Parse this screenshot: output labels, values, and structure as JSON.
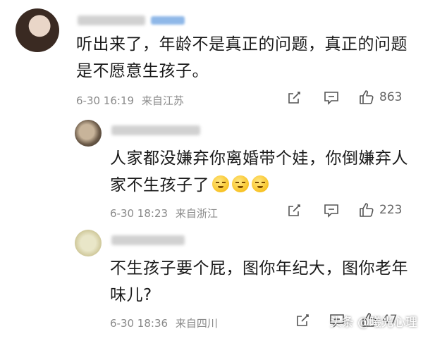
{
  "comments": [
    {
      "text": "听出来了，年龄不是真正的问题，真正的问题是不愿意生孩子。",
      "time": "6-30 16:19",
      "location": "来自江苏",
      "likes": "863"
    },
    {
      "text": "人家都没嫌弃你离婚带个娃，你倒嫌弃人家不生孩子了",
      "time": "6-30 18:23",
      "location": "来自浙江",
      "likes": "223"
    },
    {
      "text": "不生孩子要个屁，图你年纪大，图你老年味儿?",
      "time": "6-30 18:36",
      "location": "来自四川",
      "likes": "47"
    }
  ],
  "icons": {
    "share": "share-icon",
    "comment": "comment-icon",
    "like": "thumbs-up-icon"
  },
  "watermark": "头条 @曦光心理"
}
